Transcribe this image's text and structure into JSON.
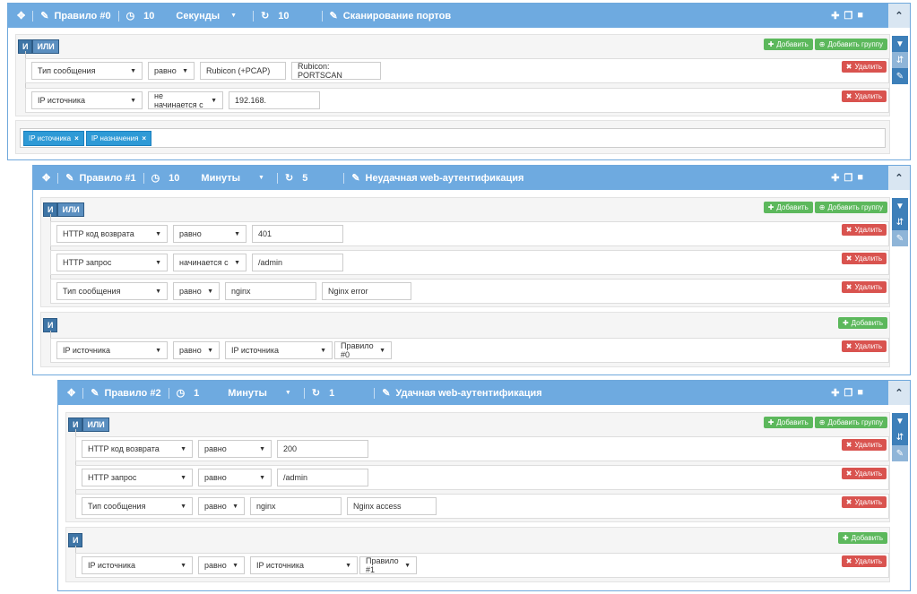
{
  "rules": [
    {
      "title": "Правило #0",
      "time_value": "10",
      "unit": "Секунды",
      "repeat": "10",
      "name": "Сканирование портов",
      "conj": [
        "И",
        "ИЛИ"
      ],
      "add": "Добавить",
      "add_group": "Добавить группу",
      "delete": "Удалить",
      "conditions": [
        {
          "field": "Тип сообщения",
          "op": "равно",
          "v1": "Rubicon (+PCAP)",
          "v2": "Rubicon: PORTSCAN"
        },
        {
          "field": "IP источника",
          "op": "не начинается с",
          "v1": "192.168."
        }
      ],
      "tags": [
        "IP источника",
        "IP назначения"
      ]
    },
    {
      "title": "Правило #1",
      "time_value": "10",
      "unit": "Минуты",
      "repeat": "5",
      "name": "Неудачная web-аутентификация",
      "conj": [
        "И",
        "ИЛИ"
      ],
      "add": "Добавить",
      "add_group": "Добавить группу",
      "delete": "Удалить",
      "conditions": [
        {
          "field": "HTTP код возврата",
          "op": "равно",
          "v1": "401"
        },
        {
          "field": "HTTP запрос",
          "op": "начинается с",
          "v1": "/admin"
        },
        {
          "field": "Тип сообщения",
          "op": "равно",
          "v1": "nginx",
          "v2": "Nginx error"
        }
      ],
      "group2": {
        "conj": "И",
        "add": "Добавить",
        "delete": "Удалить",
        "field": "IP источника",
        "op": "равно",
        "v1": "IP источника",
        "v2": "Правило #0"
      }
    },
    {
      "title": "Правило #2",
      "time_value": "1",
      "unit": "Минуты",
      "repeat": "1",
      "name": "Удачная web-аутентификация",
      "conj": [
        "И",
        "ИЛИ"
      ],
      "add": "Добавить",
      "add_group": "Добавить группу",
      "delete": "Удалить",
      "conditions": [
        {
          "field": "HTTP код возврата",
          "op": "равно",
          "v1": "200"
        },
        {
          "field": "HTTP запрос",
          "op": "равно",
          "v1": "/admin"
        },
        {
          "field": "Тип сообщения",
          "op": "равно",
          "v1": "nginx",
          "v2": "Nginx access"
        }
      ],
      "group2": {
        "conj": "И",
        "add": "Добавить",
        "delete": "Удалить",
        "field": "IP источника",
        "op": "равно",
        "v1": "IP источника",
        "v2": "Правило #1"
      }
    }
  ],
  "icons": {
    "move": "move-icon",
    "edit": "pencil-icon",
    "clock": "clock-icon",
    "repeat": "repeat-icon",
    "name": "edit-icon",
    "plus": "plus-icon",
    "copy": "copy-icon",
    "trash": "trash-icon",
    "collapse": "chevron-up-icon",
    "filter": "filter-icon",
    "sort": "sort-icon",
    "tag": "tag-icon"
  }
}
